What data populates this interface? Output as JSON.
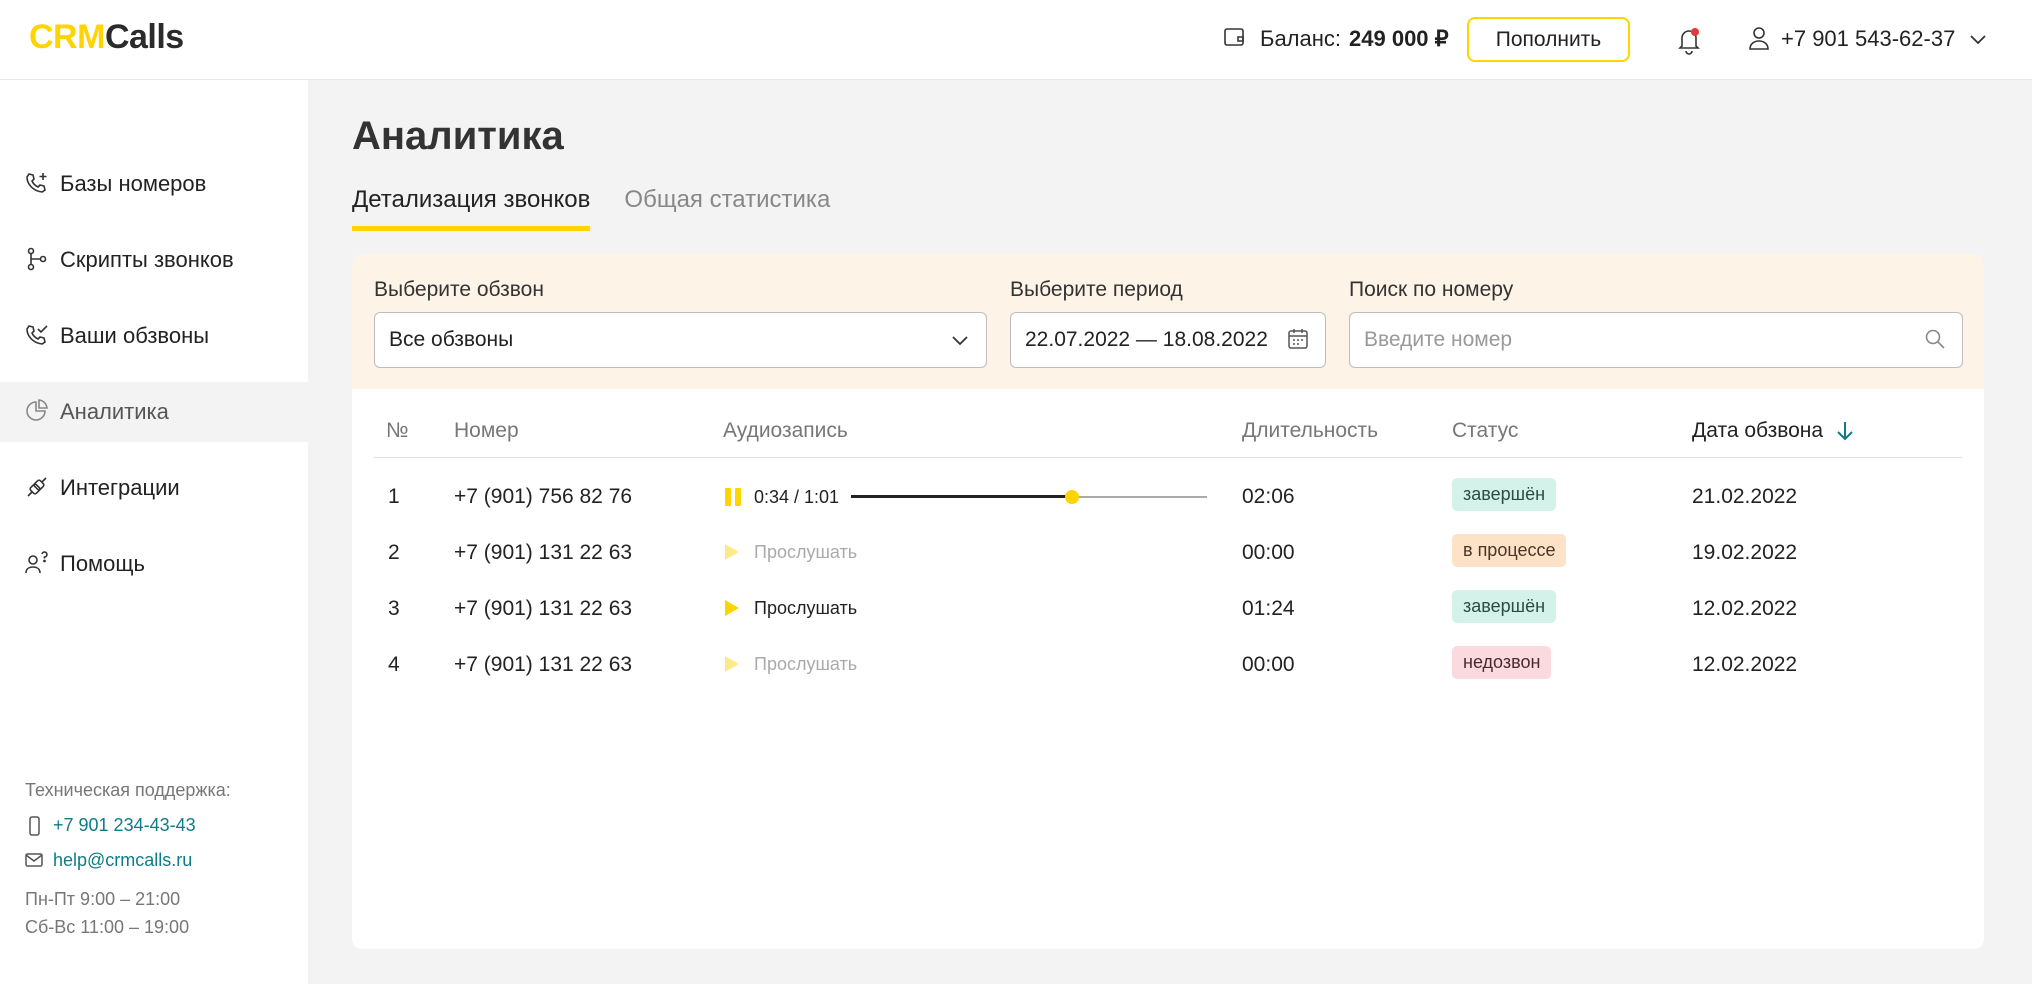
{
  "header": {
    "logo_part1": "CRM",
    "logo_part2": "Calls",
    "balance_label": "Баланс:",
    "balance_value": "249 000 ₽",
    "topup_label": "Пополнить",
    "user_phone": "+7 901 543-62-37",
    "notification_dot": true
  },
  "sidebar": {
    "items": [
      {
        "label": "Базы номеров",
        "icon": "phone-plus-icon"
      },
      {
        "label": "Скрипты звонков",
        "icon": "branch-icon"
      },
      {
        "label": "Ваши обзвоны",
        "icon": "phone-check-icon"
      },
      {
        "label": "Аналитика",
        "icon": "analytics-icon",
        "active": true
      },
      {
        "label": "Интеграции",
        "icon": "plug-icon"
      },
      {
        "label": "Помощь",
        "icon": "help-icon"
      }
    ],
    "support": {
      "title": "Техническая поддержка:",
      "phone": "+7 901 234-43-43",
      "email": "help@crmcalls.ru",
      "hours_weekdays": "Пн-Пт 9:00 – 21:00",
      "hours_weekend": "Сб-Вс 11:00 – 19:00"
    }
  },
  "main": {
    "title": "Аналитика",
    "tabs": [
      {
        "label": "Детализация звонков",
        "active": true
      },
      {
        "label": "Общая статистика",
        "active": false
      }
    ],
    "filters": {
      "campaign_label": "Выберите обзвон",
      "campaign_value": "Все обзвоны",
      "period_label": "Выберите период",
      "period_value": "22.07.2022 — 18.08.2022",
      "search_label": "Поиск по номеру",
      "search_placeholder": "Введите номер"
    },
    "table": {
      "columns": [
        "№",
        "Номер",
        "Аудиозапись",
        "Длительность",
        "Статус",
        "Дата обзвона"
      ],
      "sort_column": "Дата обзвона",
      "rows": [
        {
          "n": "1",
          "number": "+7 (901) 756 82 76",
          "audio_time": "0:34 / 1:01",
          "audio_progress": 0.62,
          "duration": "02:06",
          "status": "завершён",
          "status_kind": "done",
          "date": "21.02.2022"
        },
        {
          "n": "2",
          "number": "+7 (901) 131 22 63",
          "audio_label": "Прослушать",
          "audio_enabled": false,
          "duration": "00:00",
          "status": "в процессе",
          "status_kind": "progress",
          "date": "19.02.2022"
        },
        {
          "n": "3",
          "number": "+7 (901) 131 22 63",
          "audio_label": "Прослушать",
          "audio_enabled": true,
          "duration": "01:24",
          "status": "завершён",
          "status_kind": "done",
          "date": "12.02.2022"
        },
        {
          "n": "4",
          "number": "+7 (901) 131 22 63",
          "audio_label": "Прослушать",
          "audio_enabled": false,
          "duration": "00:00",
          "status": "недозвон",
          "status_kind": "fail",
          "date": "12.02.2022"
        }
      ]
    }
  },
  "colors": {
    "accent": "#ffd400",
    "link": "#0e7c86",
    "filter_bg": "#fdf3e7",
    "status_done": "#d4f1ea",
    "status_progress": "#fde2c7",
    "status_fail": "#fbdadf"
  }
}
